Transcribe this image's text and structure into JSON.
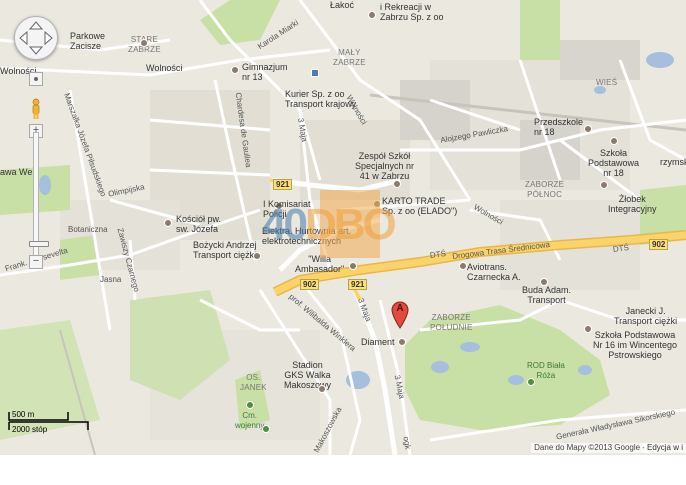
{
  "map": {
    "districts": {
      "stare_zabrze": "STARE\nZABRZE",
      "maly_zabrze": "MAŁY\nZABRZE",
      "zaborze_polnoc": "ZABORZE\nPÓŁNOC",
      "zaborze_poludnie": "ZABORZE\nPOŁUDNIE",
      "os_janek": "OS.\nJANEK",
      "wies": "WIEŚ"
    },
    "places": {
      "lekcja": "Łakoć",
      "rekreacja": "i Rekreacji w\nZabrzu Sp. z oo",
      "parkowe_zacisze": "Parkowe\nZacisze",
      "wolnosci_left": "Wolności",
      "wolnosci_mid": "Wolności",
      "gimnazjum": "Gimnazjum\nnr 13",
      "kurier": "Kurier Sp. z oo\nTransport krajowy",
      "zespol": "Zespół Szkół\nSpecjalnych nr\n41 w Zabrzu",
      "karto": "KARTO TRADE\nSp. z oo (ELADO\")",
      "komisariat": "I Komisariat\nPolicji",
      "elektra": "Elektra. Hurtownia art.\nelektrotechnicznych",
      "willa": "\"Willa\nAmbasador\"",
      "kosciol": "Kościół pw.\nsw. Józefa",
      "bozycki": "Bożycki Andrzej\nTransport ciężki",
      "przedszkole": "Przedszkole\nnr 18",
      "szkola18": "Szkoła\nPodstawowa\nnr 18",
      "zlobek": "Żłobek\nIntegracyjny",
      "rzymsk": "rzymsk",
      "aviotrans": "Aviotrans.\nCzarnecka A.",
      "buda": "Buda Adam.\nTransport",
      "janecki": "Janecki J.\nTransport ciężki",
      "szkola16": "Szkoła Podstawowa\nNr 16 im Wincentego\nPstrowskiego",
      "rod": "ROD Biała\nRóża",
      "diament": "Diament",
      "stadion": "Stadion\nGKS Walka\nMakoszowy",
      "cmentarz": "Cm.\nwojenny",
      "waw": "awa We"
    },
    "streets": {
      "karola_miarki": "Karola Miarki",
      "marszalka": "Marszałka Józefa Piłsudskiego",
      "olimpijska": "Olimpijska",
      "botaniczna": "Botaniczna",
      "zawiszy": "Zawiszy Czarnego",
      "frank_roosevelta": "Frank. Roosevelta",
      "jasna": "Jasna",
      "chardesa": "Chardesa de Gaullea",
      "trzeciego_maja_top": "3 Maja",
      "trzeciego_maja_mid": "3 Maja",
      "trzeciego_maja_low": "3 Maja",
      "wolnosci_diag": "Wolności",
      "alojzego": "Alojzego Pawliczka",
      "dts_left": "DTŚ",
      "drogowa": "Drogowa Trasa Średnicowa",
      "dts_right": "DTŚ",
      "wolnosci_right": "Wolności",
      "winkler": "prof. Wilibalda Winklera",
      "makoszowska": "Makoszowska",
      "sikorskiego": "Generała Władysława Sikorskiego",
      "ogk": "ogk"
    },
    "shields": {
      "s921a": "921",
      "s921b": "921",
      "s902a": "902",
      "s902b": "902"
    },
    "watermark": {
      "prefix": "40",
      "main": "DBO"
    },
    "marker": {
      "letter": "A",
      "color": "#e04b3f"
    },
    "scale": {
      "metric": "500 m",
      "imperial": "2000 stóp"
    },
    "attribution": "Dane do Mapy ©2013 Google -",
    "edit_link": "Edycja w i"
  },
  "colors": {
    "land": "#ebe8e0",
    "park": "#c8dfa5",
    "water": "#a5bfdd",
    "road": "#ffffff",
    "highway": "#fbd36a",
    "urban": "#e1ddd3"
  }
}
